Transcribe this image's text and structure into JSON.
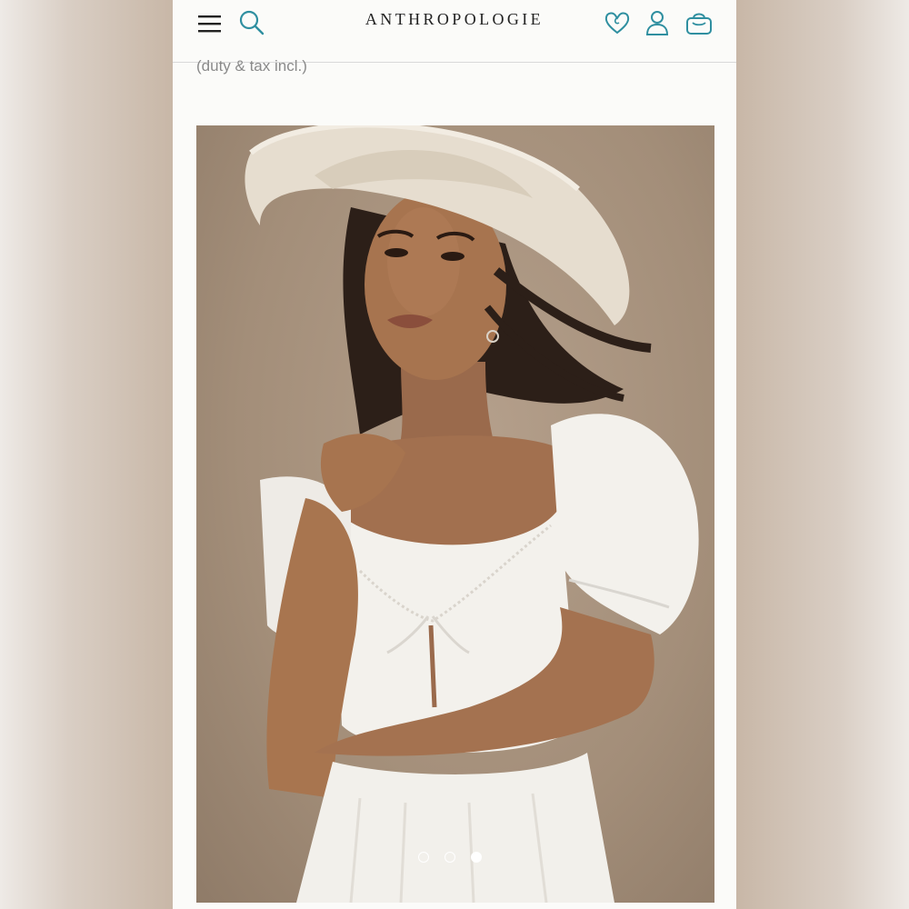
{
  "header": {
    "brand": "ANTHROPOLOGIE",
    "icons": [
      "menu-icon",
      "search-icon",
      "heart-icon",
      "user-icon",
      "bag-icon"
    ],
    "accent_color": "#2f8fa0"
  },
  "product": {
    "price_note": "(duty & tax incl.)"
  },
  "carousel": {
    "slide_count": 3,
    "active_index": 3
  }
}
